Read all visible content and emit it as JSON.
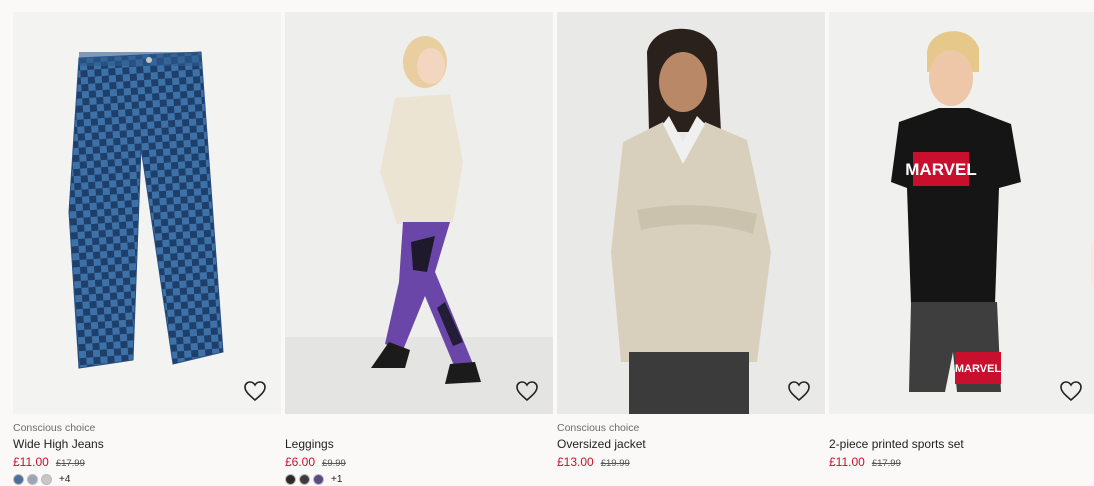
{
  "products": [
    {
      "badge": "Conscious choice",
      "title": "Wide High Jeans",
      "price": "£11.00",
      "old_price": "£17.99",
      "extra_colors": "+4",
      "image_label": "jeans"
    },
    {
      "badge": "",
      "title": "Leggings",
      "price": "£6.00",
      "old_price": "£9.99",
      "extra_colors": "+1",
      "image_label": "leggings"
    },
    {
      "badge": "Conscious choice",
      "title": "Oversized jacket",
      "price": "£13.00",
      "old_price": "£19.99",
      "extra_colors": "",
      "image_label": "jacket"
    },
    {
      "badge": "",
      "title": "2-piece printed sports set",
      "price": "£11.00",
      "old_price": "£17.99",
      "extra_colors": "",
      "image_label": "sports"
    }
  ],
  "print_text": "MARVEL",
  "icons": {
    "favourite": "heart-outline-icon"
  },
  "colors": {
    "sale_price": "#c8102e",
    "background": "#faf9f8"
  }
}
